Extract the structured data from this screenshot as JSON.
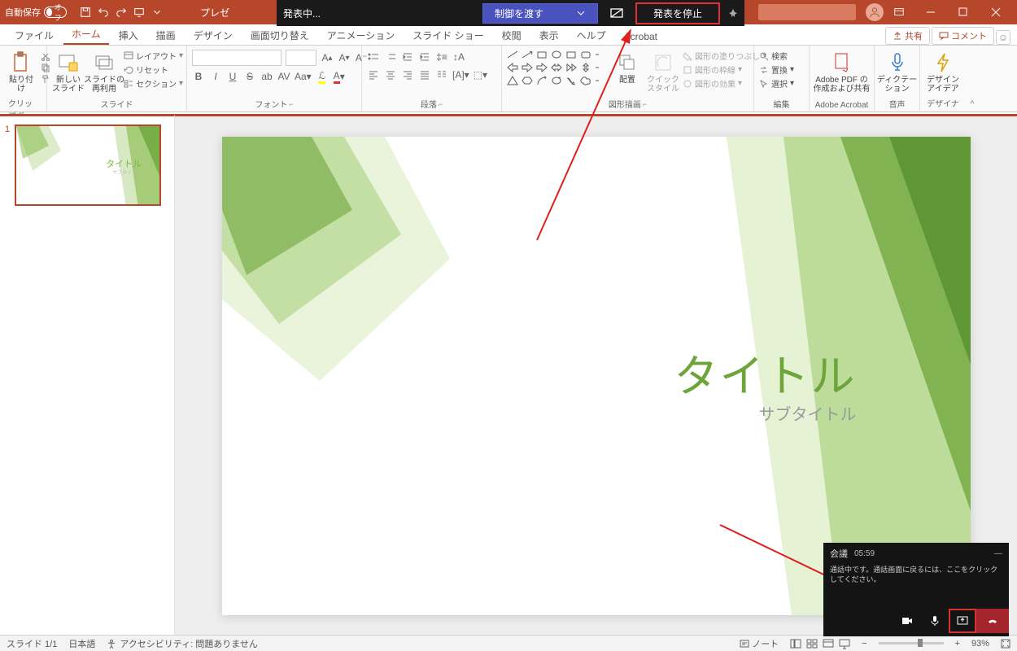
{
  "titlebar": {
    "autosave_label": "自動保存",
    "autosave_state": "オフ",
    "doc_title": "プレゼ"
  },
  "teams_top": {
    "presenting": "発表中...",
    "give_control": "制御を渡す",
    "stop": "発表を停止"
  },
  "tabs": {
    "file": "ファイル",
    "home": "ホーム",
    "insert": "挿入",
    "draw": "描画",
    "design": "デザイン",
    "transitions": "画面切り替え",
    "animations": "アニメーション",
    "slideshow": "スライド ショー",
    "review": "校閲",
    "view": "表示",
    "help": "ヘルプ",
    "acrobat": "Acrobat",
    "share": "共有",
    "comment": "コメント"
  },
  "ribbon": {
    "clipboard": {
      "paste": "貼り付け",
      "group": "クリップボード"
    },
    "slides": {
      "new_slide": "新しい\nスライド",
      "reuse": "スライドの\n再利用",
      "layout": "レイアウト",
      "reset": "リセット",
      "section": "セクション",
      "group": "スライド"
    },
    "font": {
      "group": "フォント"
    },
    "paragraph": {
      "group": "段落"
    },
    "drawing": {
      "arrange": "配置",
      "quick_styles": "クイック\nスタイル",
      "shape_fill": "図形の塗りつぶし",
      "shape_outline": "図形の枠線",
      "shape_effects": "図形の効果",
      "group": "図形描画"
    },
    "editing": {
      "find": "検索",
      "replace": "置換",
      "select": "選択",
      "group": "編集"
    },
    "adobe": {
      "btn": "Adobe PDF の\n作成および共有",
      "group": "Adobe Acrobat"
    },
    "voice": {
      "dictate": "ディクテー\nション",
      "group": "音声"
    },
    "designer": {
      "ideas": "デザイン\nアイデア",
      "group": "デザイナー"
    }
  },
  "slide": {
    "number": "1",
    "title": "タイトル",
    "subtitle": "サブタイトル"
  },
  "status": {
    "slide_count": "スライド 1/1",
    "language": "日本語",
    "accessibility": "アクセシビリティ: 問題ありません",
    "notes": "ノート",
    "zoom": "93%"
  },
  "teams_mini": {
    "title": "会議",
    "time": "05:59",
    "msg": "通話中です。通話画面に戻るには、ここをクリックしてください。"
  }
}
